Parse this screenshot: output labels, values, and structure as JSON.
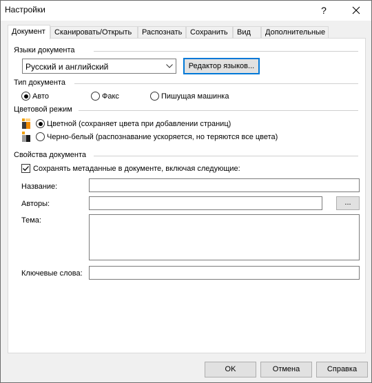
{
  "window": {
    "title": "Настройки",
    "help_label": "?"
  },
  "tabs": [
    {
      "label": "Документ",
      "active": true
    },
    {
      "label": "Сканировать/Открыть"
    },
    {
      "label": "Распознать"
    },
    {
      "label": "Сохранить"
    },
    {
      "label": "Вид"
    },
    {
      "label": "Дополнительные"
    }
  ],
  "languages": {
    "title": "Языки документа",
    "selected": "Русский и английский",
    "editor_button": "Редактор языков..."
  },
  "doc_type": {
    "title": "Тип документа",
    "options": [
      {
        "label": "Авто",
        "selected": true
      },
      {
        "label": "Факс",
        "selected": false
      },
      {
        "label": "Пишущая машинка",
        "selected": false
      }
    ]
  },
  "color_mode": {
    "title": "Цветовой режим",
    "options": [
      {
        "label": "Цветной (сохраняет цвета при добавлении страниц)",
        "selected": true
      },
      {
        "label": "Черно-белый (распознавание ускоряется, но теряются все цвета)",
        "selected": false
      }
    ]
  },
  "properties": {
    "title": "Свойства документа",
    "save_metadata": {
      "label": "Сохранять метаданные в документе, включая следующие:",
      "checked": true
    },
    "fields": {
      "title_label": "Название:",
      "title_value": "",
      "authors_label": "Авторы:",
      "authors_value": "",
      "browse_label": "...",
      "subject_label": "Тема:",
      "subject_value": "",
      "keywords_label": "Ключевые слова:",
      "keywords_value": ""
    }
  },
  "footer": {
    "ok": "OK",
    "cancel": "Отмена",
    "help": "Справка"
  },
  "colors": {
    "accent": "#0078d7",
    "checkmark": "#000000",
    "color_icon_orange": "#f08a00",
    "color_icon_dark": "#3a3a3a"
  }
}
